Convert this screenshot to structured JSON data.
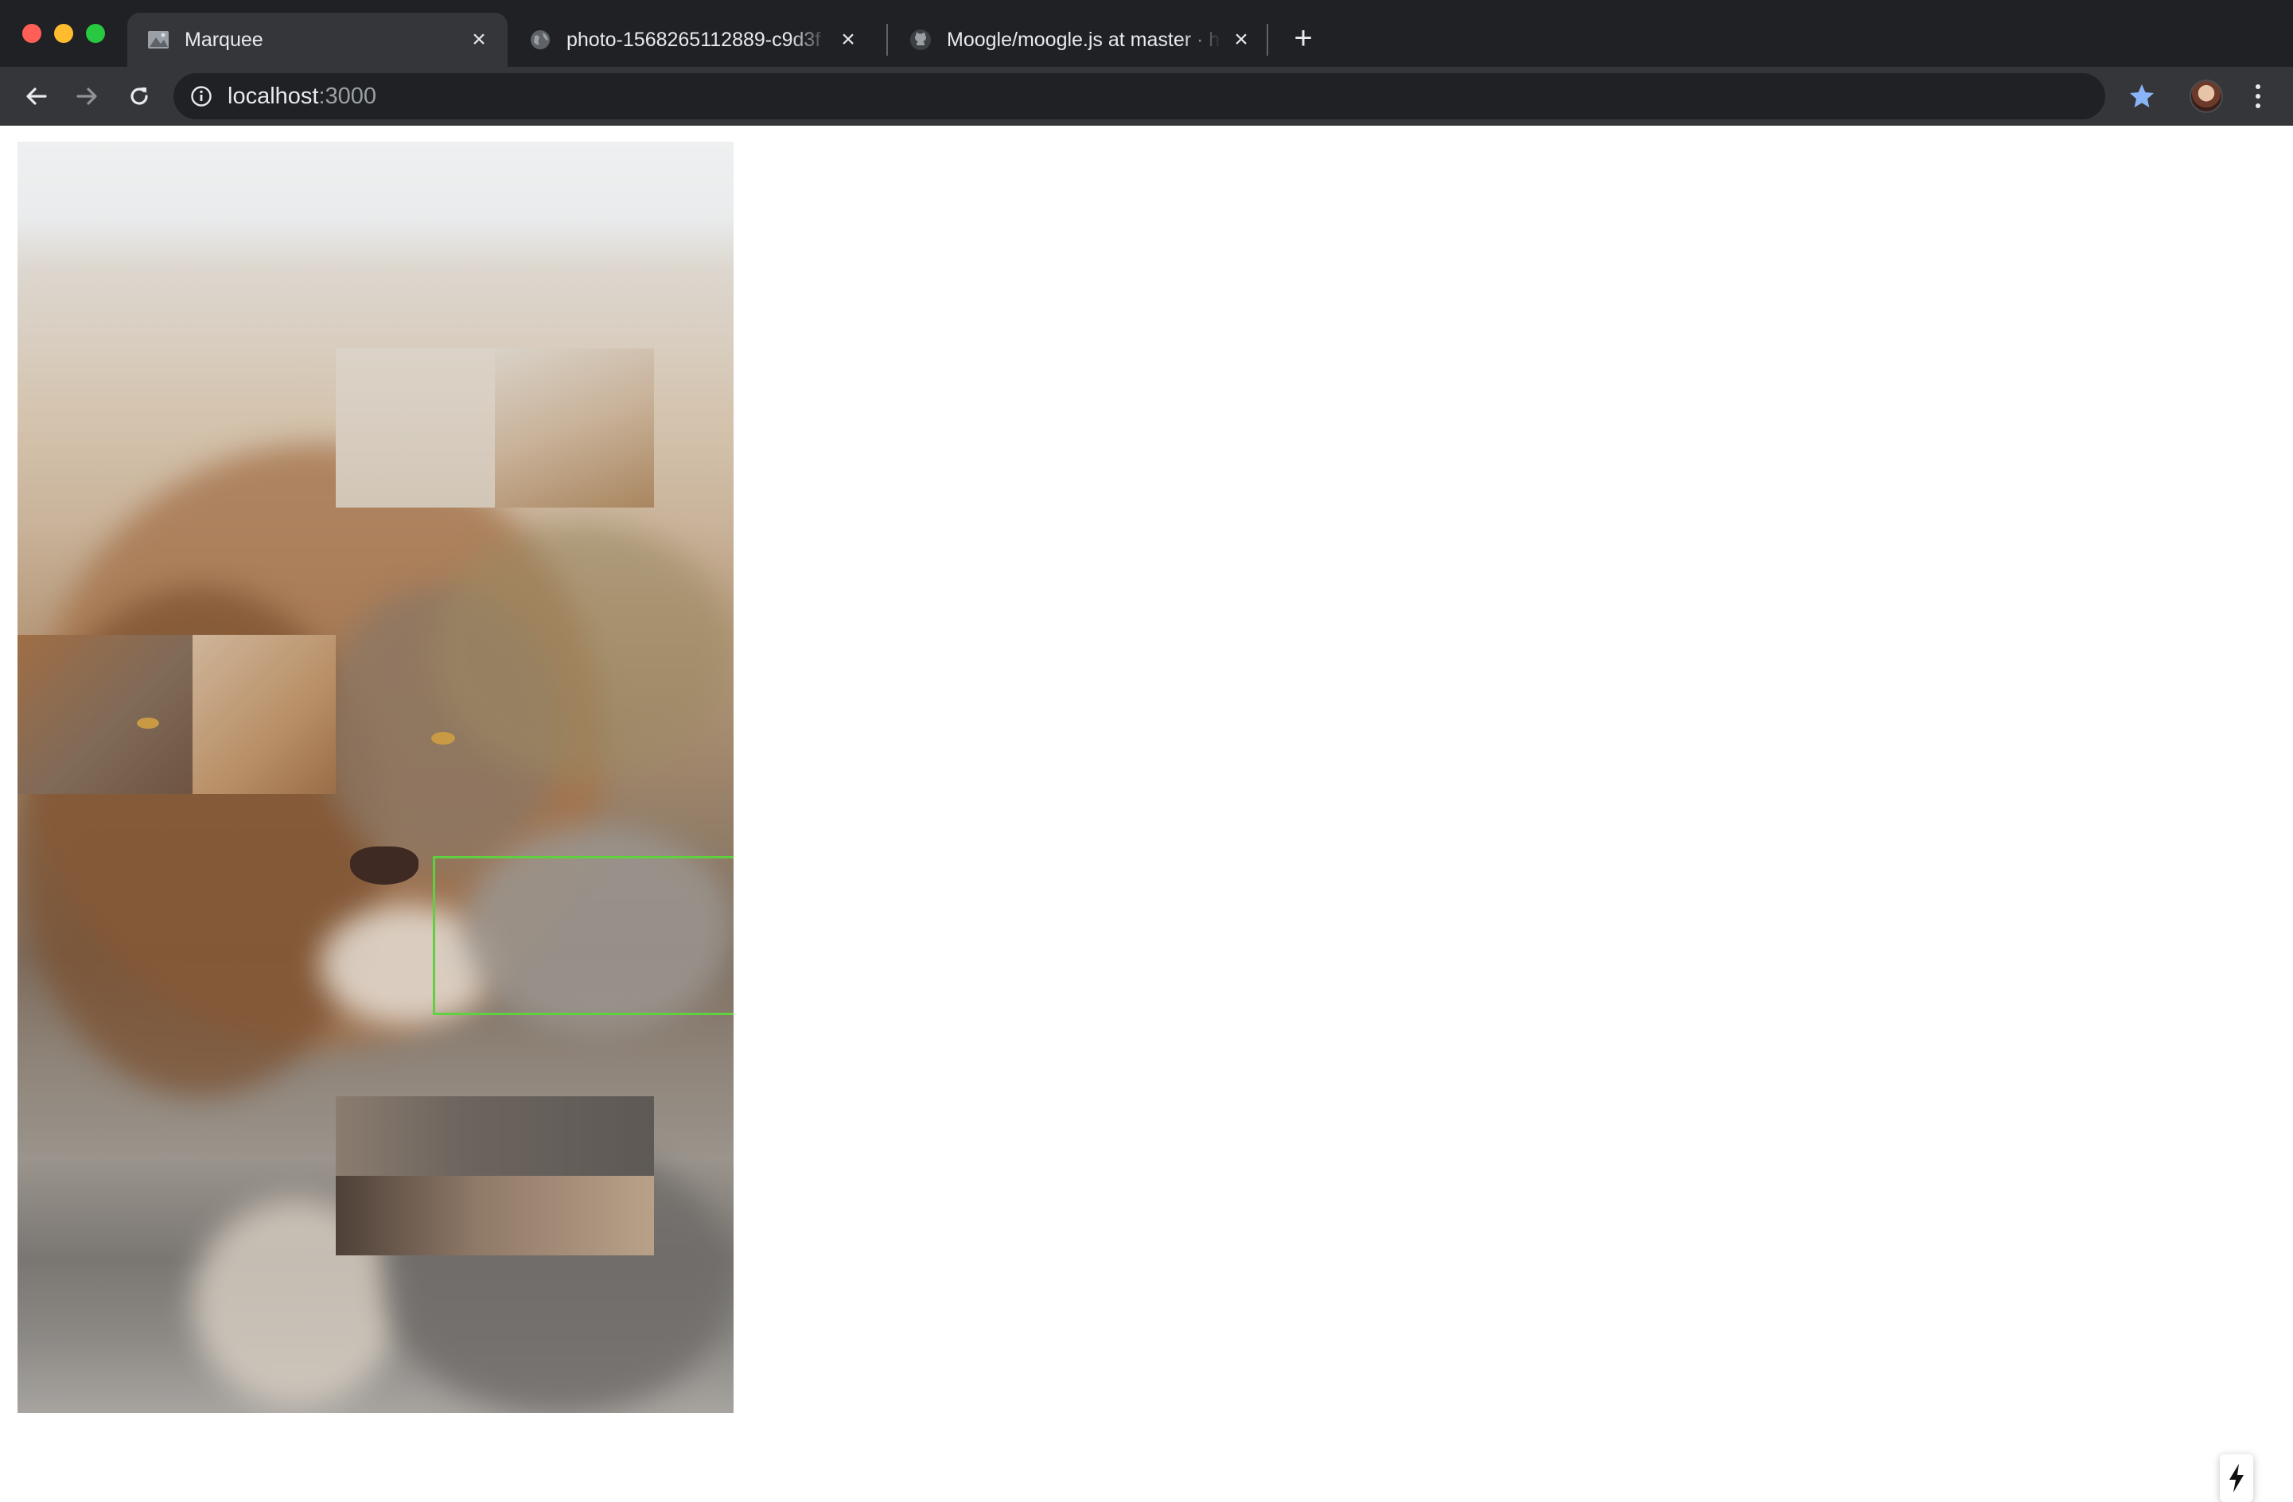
{
  "browser": {
    "tabs": [
      {
        "title": "Marquee",
        "favicon": "image-icon",
        "active": true
      },
      {
        "title": "photo-1568265112889-c9d3f",
        "favicon": "globe-icon",
        "active": false
      },
      {
        "title": "Moogle/moogle.js at master · h",
        "favicon": "github-icon",
        "active": false
      }
    ],
    "close_glyph": "×",
    "new_tab_glyph": "+",
    "address": {
      "host": "localhost",
      "port": ":3000"
    },
    "bookmarked": true,
    "accent": "#8ab4f8"
  },
  "page": {
    "image_subject": "lion",
    "selection_color": "#5fd13f"
  }
}
